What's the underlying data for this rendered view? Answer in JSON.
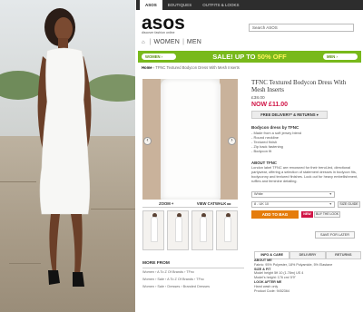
{
  "store": {
    "nav_tabs": [
      "ASOS",
      "BOUTIQUES",
      "OUTFITS & LOOKS"
    ],
    "logo": "asos",
    "tagline": "discover fashion online",
    "search_placeholder": "Search ASOS",
    "gender_women": "WOMEN",
    "gender_men": "MEN",
    "sale_left": "WOMEN ›",
    "sale_text": "SALE! UP TO ",
    "sale_percent": "50% OFF",
    "sale_right": "MEN ›",
    "breadcrumb_home": "Home",
    "breadcrumb_rest": " › TFNC Textured Bodycon Dress With Mesh Inserts"
  },
  "product": {
    "title": "TFNC Textured Bodycon Dress With Mesh Inserts",
    "was_price": "£38.00",
    "now_price": "NOW £11.00",
    "delivery_label": "FREE DELIVERY* & RETURNS ▾",
    "desc_heading": "Bodycon dress by TFNC",
    "desc_items": [
      "- Made from a soft jersey blend",
      "- Round neckline",
      "- Textured finish",
      "- Zip back fastening",
      "- Bodycon fit"
    ],
    "about_heading": "ABOUT TFNC",
    "about_text": "London label TFNC are renowned for their trend-led, directional partywear, offering a selection of statement dresses in bodycon fits, bodyconny and textured finishes. Look out for heavy embellishment, ruffles and feminine detailing.",
    "colour_select": "White",
    "size_select": "8 - UK 10",
    "size_guide": "SIZE GUIDE",
    "add_to_bag": "ADD TO BAG",
    "new_badge": "NEW",
    "buy_the_look": "BUY THE LOOK",
    "save_for_later": "SAVE FOR LATER",
    "zoom_label": "ZOOM +",
    "catwalk_label": "VIEW CATWALK ▸▸",
    "info_tabs": [
      "INFO & CARE",
      "DELIVERY",
      "RETURNS"
    ],
    "info_about_h": "ABOUT ME",
    "info_about": "Fabric: 95% Polyester, 18% Polyamide, 5% Elastane",
    "info_size_h": "SIZE & FIT",
    "info_size_1": "Model height 5ft 10 (1.78m) US 4",
    "info_size_2": "Model's height: 176 cm/ 5'9\"",
    "info_look_h": "LOOK AFTER ME",
    "info_look": "Hand wash only",
    "info_code": "Product Code: 9452364"
  },
  "more_from": {
    "heading": "MORE FROM",
    "rows": [
      "Women  ›  A To Z Of Brands  ›  TFnc",
      "Women  ›  Sale  ›  A To Z Of Brands  ›  TFnc",
      "Women  ›  Sale  ›  Dresses  ›  Branded Dresses"
    ]
  },
  "colors": {
    "sale_green": "#78b91b",
    "price_red": "#d01345",
    "bag_orange": "#e57c0c"
  }
}
